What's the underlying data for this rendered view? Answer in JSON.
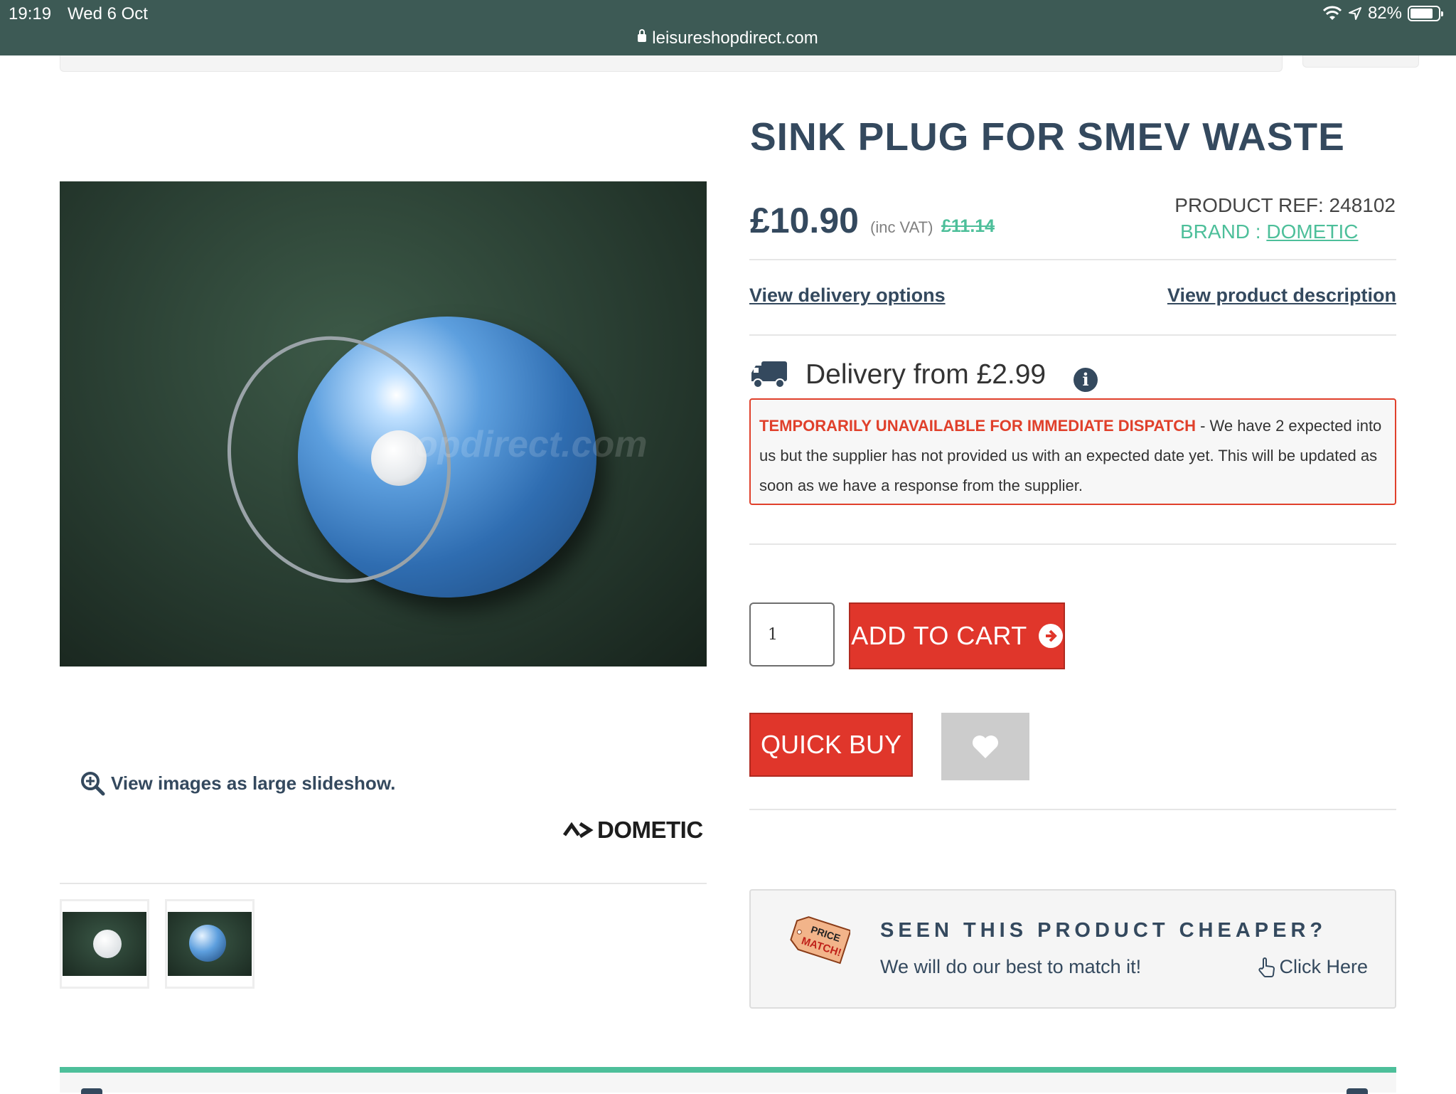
{
  "status_bar": {
    "time": "19:19",
    "date": "Wed 6 Oct",
    "battery": "82%",
    "battery_level": 0.82
  },
  "browser": {
    "url": "leisureshopdirect.com"
  },
  "product": {
    "title": "SINK PLUG FOR SMEV WASTE",
    "price": "£10.90",
    "vat_note": "(inc VAT)",
    "old_price": "£11.14",
    "ref": "PRODUCT REF: 248102",
    "brand_label": "BRAND : ",
    "brand_name": "DOMETIC",
    "image_watermark": "opdirect.com"
  },
  "gallery": {
    "slideshow_link": "View images as large slideshow.",
    "brand_logo_text": "DOMETIC"
  },
  "links": {
    "delivery_options": "View delivery options",
    "product_description": "View product description"
  },
  "delivery": {
    "text": "Delivery from £2.99",
    "info_glyph": "i"
  },
  "notice": {
    "warning": "TEMPORARILY UNAVAILABLE FOR IMMEDIATE DISPATCH",
    "message": " - We have 2 expected into us but the supplier has not provided us with an expected date yet. This will be updated as soon as we have a response from the supplier."
  },
  "cart": {
    "quantity": "1",
    "add_to_cart": "ADD TO CART",
    "quick_buy": "QUICK BUY"
  },
  "price_match": {
    "tag_line1": "PRICE",
    "tag_line2": "MATCH!",
    "heading": "SEEN THIS PRODUCT CHEAPER?",
    "subtext": "We will do our best to match it!",
    "click": "Click Here"
  },
  "colors": {
    "accent_green": "#4dbf9a",
    "button_red": "#e0362b",
    "text_navy": "#34495e",
    "topbar": "#3d5a55"
  }
}
